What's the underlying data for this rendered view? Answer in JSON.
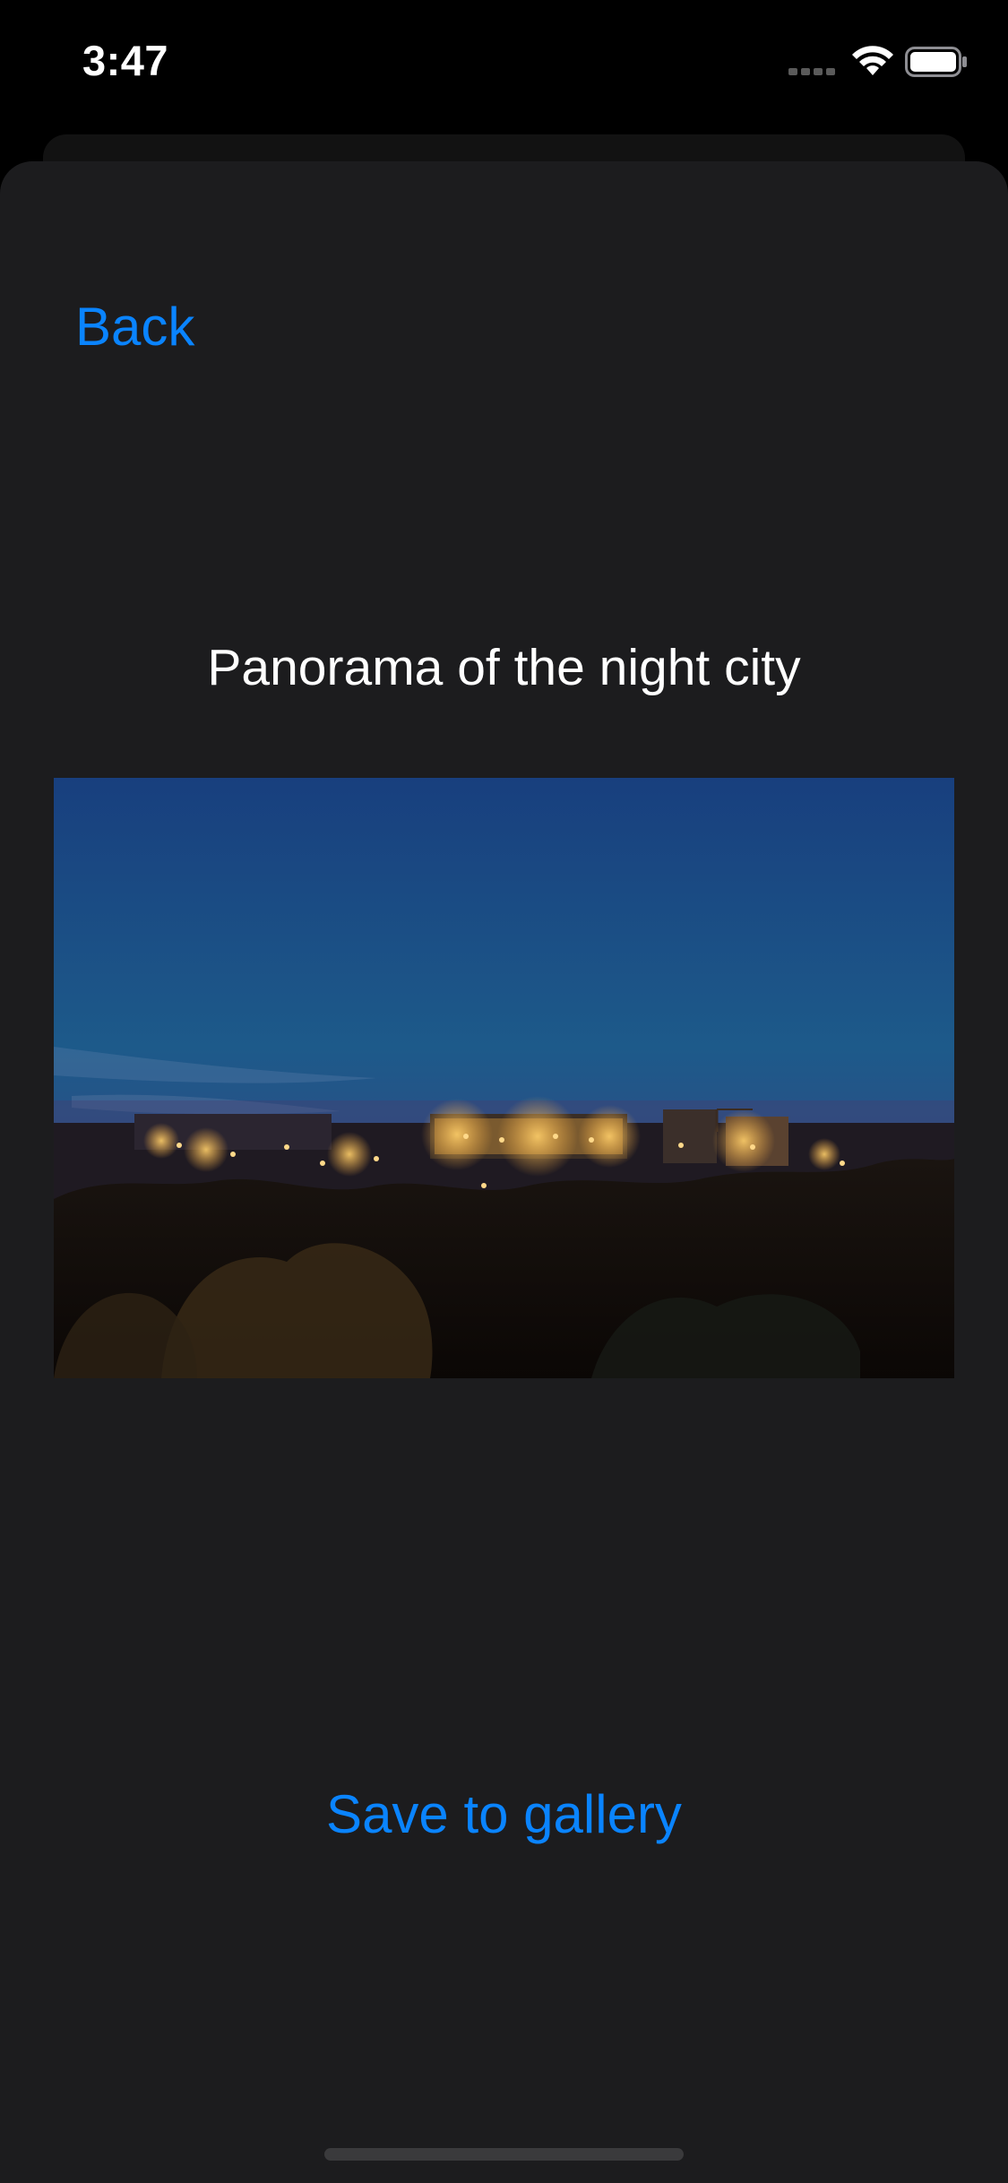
{
  "status_bar": {
    "time": "3:47",
    "icons": [
      "cellular-icon",
      "wifi-icon",
      "battery-icon"
    ]
  },
  "navigation": {
    "back_label": "Back"
  },
  "content": {
    "title": "Panorama of the night city",
    "image_description_icon": "night-city-photo"
  },
  "actions": {
    "save_label": "Save to gallery"
  },
  "colors": {
    "background": "#000000",
    "sheet": "#1c1c1e",
    "accent": "#0a84ff",
    "text": "#ffffff"
  }
}
